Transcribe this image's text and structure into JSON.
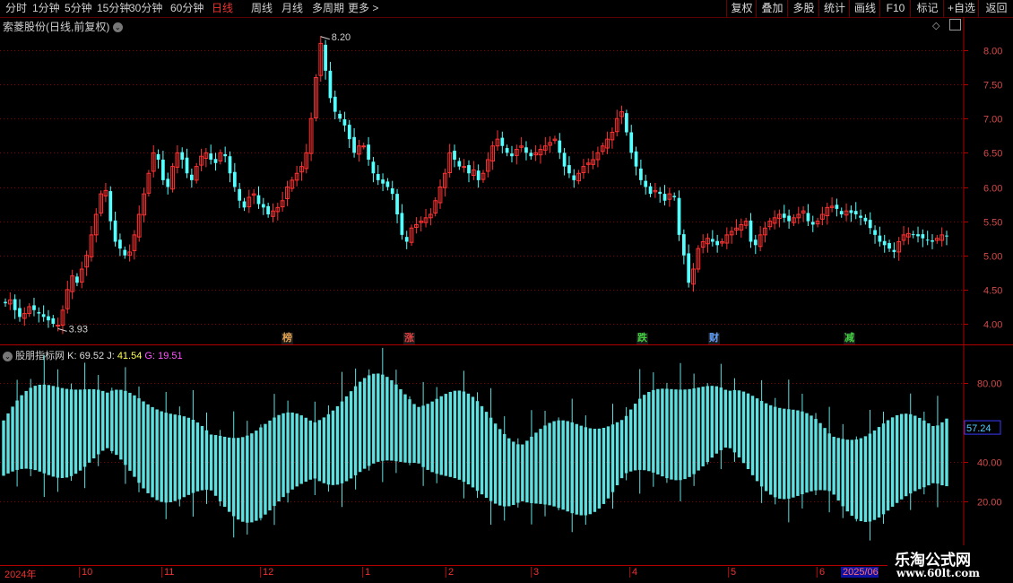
{
  "toolbar": {
    "tabs": [
      "分时",
      "1分钟",
      "5分钟",
      "15分钟",
      "30分钟",
      "60分钟",
      "日线",
      "周线",
      "月线",
      "多周期",
      "更多 >"
    ],
    "active_tab": "日线",
    "right_buttons": [
      "复权",
      "叠加",
      "多股",
      "统计",
      "画线",
      "F10",
      "标记",
      "+自选",
      "返回"
    ]
  },
  "main_chart": {
    "title": "索菱股份(日线,前复权)",
    "high_label": "8.20",
    "low_label": "3.93",
    "y_ticks": [
      "8.00",
      "7.50",
      "7.00",
      "6.50",
      "6.00",
      "5.50",
      "5.00",
      "4.50",
      "4.00"
    ],
    "tags": [
      {
        "text": "榜",
        "color": "#e0a050"
      },
      {
        "text": "涨",
        "color": "#e04040"
      },
      {
        "text": "跌",
        "color": "#40d040"
      },
      {
        "text": "财",
        "color": "#60a0ff"
      },
      {
        "text": "减",
        "color": "#40d040"
      }
    ]
  },
  "indicator": {
    "name": "股朋指标网",
    "k_label": "K:",
    "k_value": "69.52",
    "j_label": "J:",
    "j_value": "41.54",
    "g_label": "G:",
    "g_value": "19.51",
    "y_ticks": [
      "80.00",
      "40.00",
      "20.00"
    ],
    "current_value": "57.24"
  },
  "date_axis": {
    "labels": [
      "2024年",
      "10",
      "11",
      "12",
      "1",
      "2",
      "3",
      "4",
      "5",
      "6",
      "2025/06"
    ]
  },
  "watermark": {
    "title": "乐淘公式网",
    "url": "www.60lt.com"
  },
  "colors": {
    "up": "#ff3232",
    "down": "#54ffff",
    "grid": "#8a0000",
    "indicator": "#5fe0e0"
  },
  "chart_data": [
    {
      "type": "candlestick",
      "title": "索菱股份(日线,前复权)",
      "ylim": [
        3.8,
        8.4
      ],
      "closes": [
        4.3,
        4.35,
        4.2,
        4.1,
        4.15,
        4.25,
        4.2,
        4.15,
        4.1,
        4.05,
        4.0,
        3.98,
        4.2,
        4.5,
        4.7,
        4.6,
        4.8,
        5.0,
        5.3,
        5.6,
        5.9,
        5.95,
        5.5,
        5.2,
        5.1,
        5.0,
        5.05,
        5.3,
        5.6,
        5.9,
        6.2,
        6.5,
        6.4,
        6.1,
        6.0,
        6.3,
        6.5,
        6.4,
        6.2,
        6.1,
        6.3,
        6.45,
        6.5,
        6.4,
        6.35,
        6.5,
        6.45,
        6.2,
        6.0,
        5.8,
        5.7,
        5.85,
        5.9,
        5.75,
        5.7,
        5.6,
        5.65,
        5.7,
        5.8,
        6.0,
        6.1,
        6.2,
        6.3,
        6.5,
        7.0,
        7.6,
        8.1,
        7.7,
        7.3,
        7.1,
        7.0,
        6.9,
        6.7,
        6.5,
        6.6,
        6.6,
        6.4,
        6.2,
        6.1,
        6.05,
        6.0,
        5.9,
        5.6,
        5.3,
        5.2,
        5.4,
        5.45,
        5.5,
        5.55,
        5.6,
        5.8,
        6.0,
        6.2,
        6.5,
        6.4,
        6.3,
        6.3,
        6.2,
        6.25,
        6.1,
        6.2,
        6.4,
        6.6,
        6.7,
        6.6,
        6.5,
        6.45,
        6.55,
        6.6,
        6.5,
        6.45,
        6.5,
        6.55,
        6.6,
        6.65,
        6.7,
        6.5,
        6.3,
        6.2,
        6.1,
        6.2,
        6.3,
        6.35,
        6.4,
        6.5,
        6.6,
        6.7,
        6.8,
        7.0,
        7.1,
        6.8,
        6.5,
        6.3,
        6.1,
        6.0,
        5.9,
        5.95,
        5.9,
        5.8,
        5.9,
        5.85,
        5.3,
        5.0,
        4.6,
        4.8,
        5.1,
        5.2,
        5.25,
        5.2,
        5.15,
        5.2,
        5.3,
        5.35,
        5.4,
        5.45,
        5.5,
        5.2,
        5.15,
        5.3,
        5.4,
        5.5,
        5.55,
        5.6,
        5.55,
        5.5,
        5.55,
        5.6,
        5.65,
        5.5,
        5.45,
        5.5,
        5.6,
        5.7,
        5.72,
        5.68,
        5.6,
        5.65,
        5.62,
        5.6,
        5.55,
        5.5,
        5.4,
        5.3,
        5.2,
        5.15,
        5.1,
        5.05,
        5.2,
        5.3,
        5.32,
        5.3,
        5.28,
        5.25,
        5.22,
        5.2,
        5.25,
        5.3,
        5.28
      ],
      "high": 8.2,
      "low": 3.93
    },
    {
      "type": "bar",
      "title": "股朋指标网",
      "ylim": [
        0,
        100
      ],
      "series": [
        {
          "name": "K",
          "last": 69.52
        },
        {
          "name": "J",
          "last": 41.54
        },
        {
          "name": "G",
          "last": 19.51
        }
      ],
      "current": 57.24
    }
  ]
}
